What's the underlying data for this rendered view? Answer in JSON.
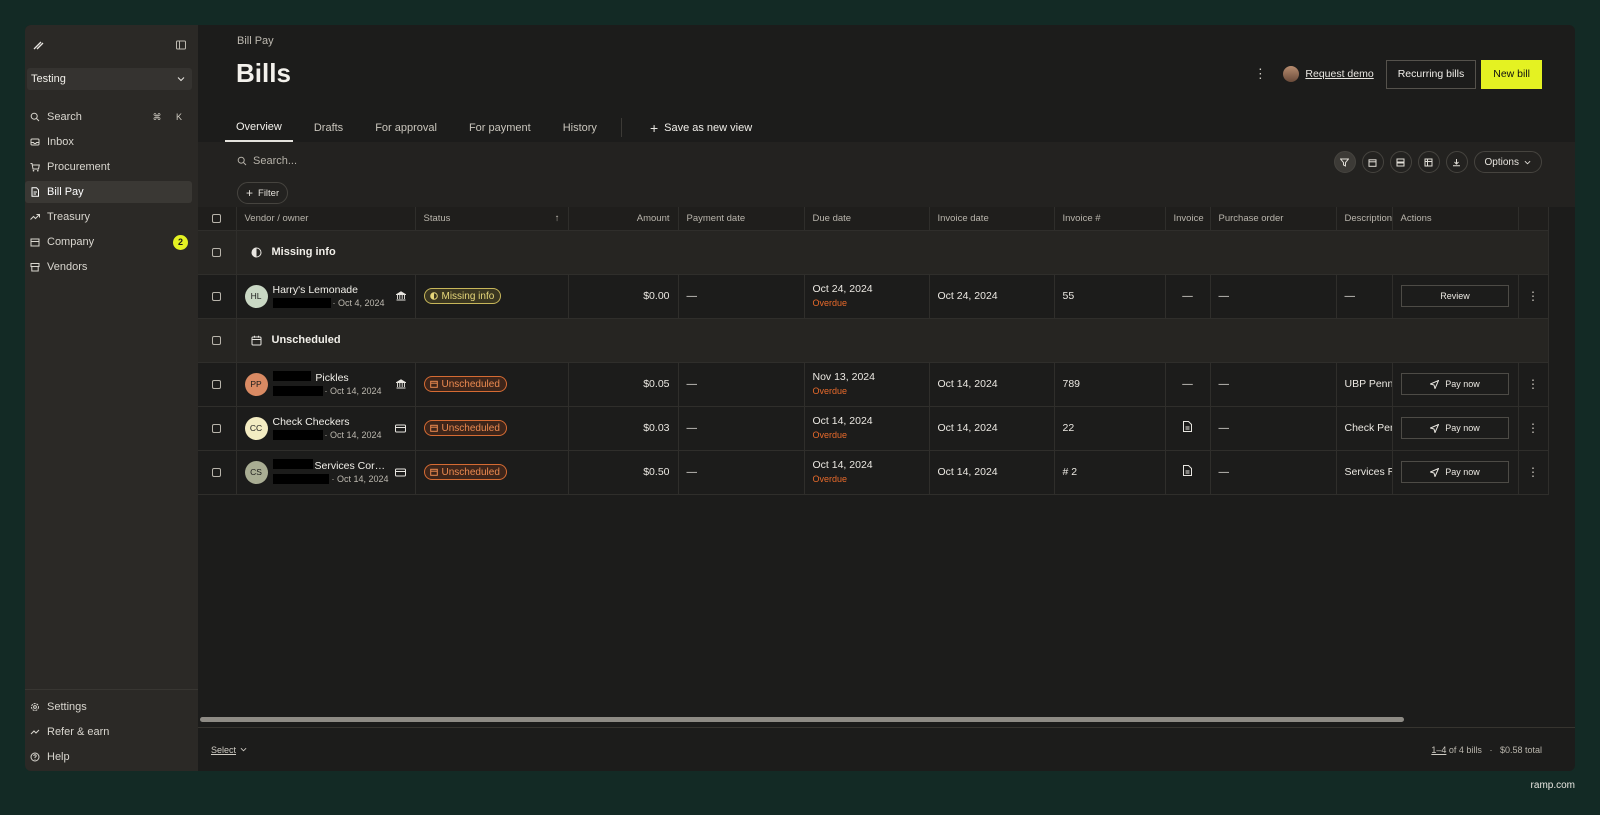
{
  "sidebar": {
    "business": "Testing",
    "search_shortcut": "⌘ K",
    "items": [
      {
        "label": "Search"
      },
      {
        "label": "Inbox"
      },
      {
        "label": "Procurement"
      },
      {
        "label": "Bill Pay"
      },
      {
        "label": "Treasury"
      },
      {
        "label": "Company",
        "badge": "2"
      },
      {
        "label": "Vendors"
      }
    ],
    "bottom": [
      {
        "label": "Settings"
      },
      {
        "label": "Refer & earn"
      },
      {
        "label": "Help"
      }
    ]
  },
  "header": {
    "breadcrumb": "Bill Pay",
    "title": "Bills",
    "request_demo": "Request demo",
    "recurring_bills": "Recurring bills",
    "new_bill": "New bill"
  },
  "tabs": [
    {
      "label": "Overview",
      "active": true
    },
    {
      "label": "Drafts"
    },
    {
      "label": "For approval"
    },
    {
      "label": "For payment"
    },
    {
      "label": "History"
    }
  ],
  "save_view": "Save as new view",
  "toolbar": {
    "search_placeholder": "Search...",
    "filter": "Filter",
    "options": "Options"
  },
  "table": {
    "columns": [
      "Vendor / owner",
      "Status",
      "Amount",
      "Payment date",
      "Due date",
      "Invoice date",
      "Invoice #",
      "Invoice",
      "Purchase order",
      "Description",
      "Actions"
    ],
    "groups": [
      {
        "label": "Missing info",
        "rows": [
          {
            "initials": "HL",
            "avatar_color": "#c9d8c4",
            "vendor": "Harry's Lemonade",
            "sub_date": "· Oct 4, 2024",
            "status": "Missing info",
            "amount": "$0.00",
            "payment_date": "—",
            "due_date": "Oct 24, 2024",
            "due_note": "Overdue",
            "invoice_date": "Oct 24, 2024",
            "invoice_no": "55",
            "invoice": "—",
            "po": "—",
            "description": "—",
            "action": "Review"
          }
        ]
      },
      {
        "label": "Unscheduled",
        "rows": [
          {
            "initials": "PP",
            "avatar_color": "#d98a63",
            "vendor": "Pickles",
            "sub_date": "· Oct 14, 2024",
            "status": "Unscheduled",
            "amount": "$0.05",
            "payment_date": "—",
            "due_date": "Nov 13, 2024",
            "due_note": "Overdue",
            "invoice_date": "Oct 14, 2024",
            "invoice_no": "789",
            "invoice": "—",
            "po": "—",
            "description": "UBP Penny",
            "action": "Pay now"
          },
          {
            "initials": "CC",
            "avatar_color": "#f3ecc2",
            "vendor": "Check Checkers",
            "sub_date": "· Oct 14, 2024",
            "status": "Unscheduled",
            "amount": "$0.03",
            "payment_date": "—",
            "due_date": "Oct 14, 2024",
            "due_note": "Overdue",
            "invoice_date": "Oct 14, 2024",
            "invoice_no": "22",
            "invoice": "doc",
            "po": "—",
            "description": "Check Pen",
            "action": "Pay now"
          },
          {
            "initials": "CS",
            "avatar_color": "#a9ad93",
            "vendor": "Services Corpor...",
            "sub_date": "· Oct 14, 2024",
            "status": "Unscheduled",
            "amount": "$0.50",
            "payment_date": "—",
            "due_date": "Oct 14, 2024",
            "due_note": "Overdue",
            "invoice_date": "Oct 14, 2024",
            "invoice_no": "# 2",
            "invoice": "doc",
            "po": "—",
            "description": "Services R",
            "action": "Pay now"
          }
        ]
      }
    ]
  },
  "footer": {
    "select": "Select",
    "range": "1–4",
    "of_total": " of 4 bills",
    "sum": "$0.58 total"
  },
  "brand": "ramp.com"
}
